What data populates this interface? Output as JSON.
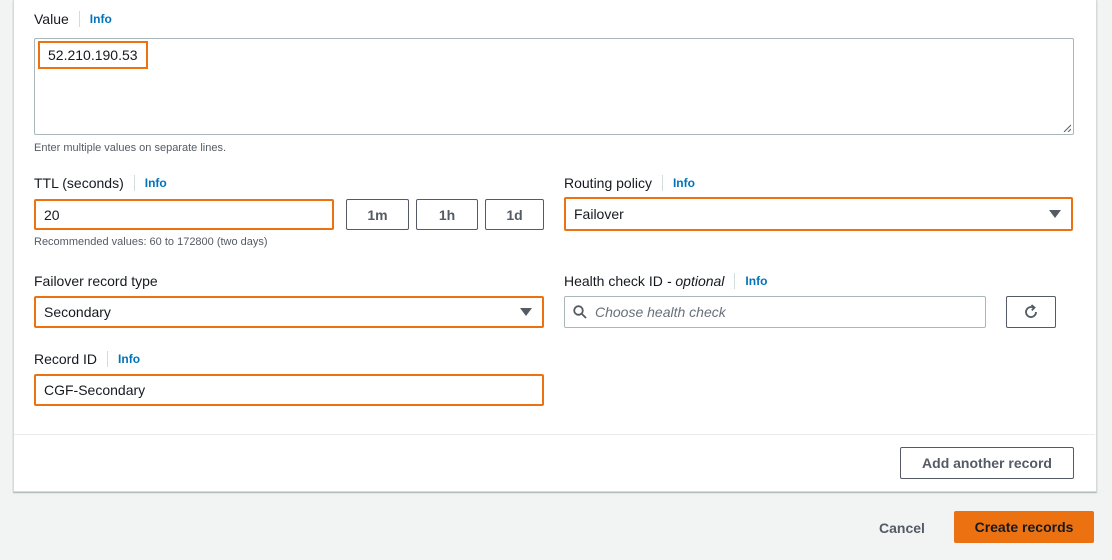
{
  "value": {
    "label": "Value",
    "info": "Info",
    "text": "52.210.190.53",
    "hint": "Enter multiple values on separate lines."
  },
  "ttl": {
    "label": "TTL (seconds)",
    "info": "Info",
    "value": "20",
    "btn_1m": "1m",
    "btn_1h": "1h",
    "btn_1d": "1d",
    "hint": "Recommended values: 60 to 172800 (two days)"
  },
  "routing": {
    "label": "Routing policy",
    "info": "Info",
    "selected": "Failover"
  },
  "failover_type": {
    "label": "Failover record type",
    "selected": "Secondary"
  },
  "health_check": {
    "label": "Health check ID",
    "optional": "- optional",
    "info": "Info",
    "placeholder": "Choose health check"
  },
  "record_id": {
    "label": "Record ID",
    "info": "Info",
    "value": "CGF-Secondary"
  },
  "actions": {
    "add_another": "Add another record",
    "cancel": "Cancel",
    "create": "Create records"
  },
  "colors": {
    "accent": "#ec7211",
    "link": "#0073bb"
  }
}
